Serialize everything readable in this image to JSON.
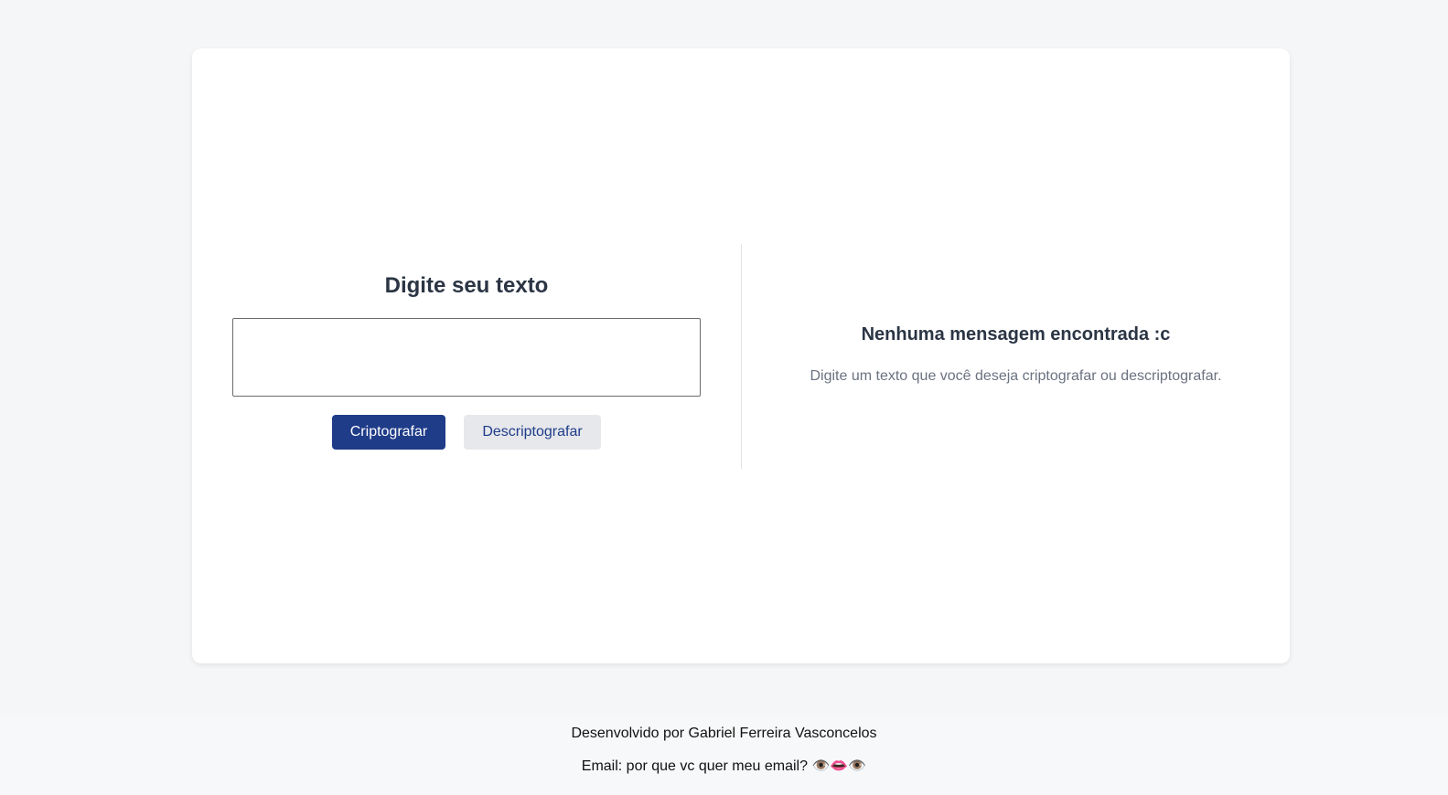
{
  "encrypt_panel": {
    "title": "Digite seu texto",
    "input_value": "",
    "input_placeholder": "",
    "encrypt_button_label": "Criptografar",
    "decrypt_button_label": "Descriptografar"
  },
  "result_panel": {
    "title": "Nenhuma mensagem encontrada :c",
    "description": "Digite um texto que você deseja criptografar ou descriptografar."
  },
  "footer": {
    "credit": "Desenvolvido por Gabriel Ferreira Vasconcelos",
    "email": "Email: por que vc quer meu email? 👁️👄👁️"
  },
  "colors": {
    "page_background": "#f5f6f8",
    "card_background": "#ffffff",
    "primary": "#1f3c88",
    "secondary_button": "#e6e8ec",
    "heading": "#2b3544",
    "muted_text": "#6b7280"
  }
}
